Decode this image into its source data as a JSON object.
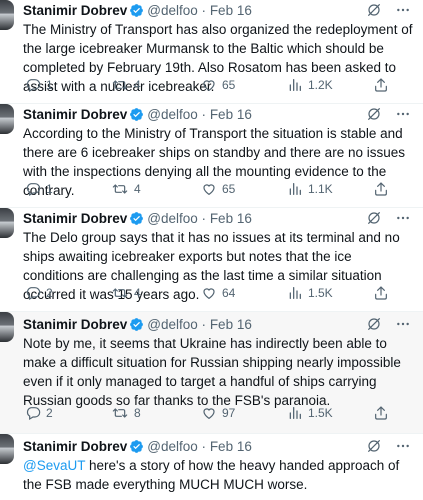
{
  "author": {
    "name": "Stanimir Dobrev",
    "handle": "@delfoo",
    "sep": "·",
    "date": "Feb 16"
  },
  "colors": {
    "accent": "#1d9bf0",
    "text": "#0f1419",
    "secondary": "#536471",
    "highlight_bg": "#f7f7f7"
  },
  "icons": {
    "top": [
      "grok-slash-icon",
      "more-icon"
    ],
    "actions": [
      "reply-icon",
      "retweet-icon",
      "like-icon",
      "views-icon",
      "share-icon"
    ]
  },
  "tweets": [
    {
      "text": "The Ministry of Transport has also organized the redeployment of the large icebreaker Murmansk to the Baltic which should be completed by February 19th. Also Rosatom has been asked to assist with a nuclear icebreaker.",
      "replies": "1",
      "retweets": "4",
      "likes": "65",
      "views": "1.2K"
    },
    {
      "text": "According to the Ministry of Transport the situation is stable and there are 6 icebreaker ships on standby and there are no issues with the inspections denying all the mounting evidence to the contrary.",
      "replies": "1",
      "retweets": "4",
      "likes": "65",
      "views": "1.1K"
    },
    {
      "text": "The Delo group says that it has no issues at its terminal and no ships awaiting icebreaker exports but notes that the ice conditions are challenging as the last time a similar situation occurred it was 15 years ago.",
      "replies": "2",
      "retweets": "4",
      "likes": "64",
      "views": "1.5K"
    },
    {
      "text": "Note by me, it seems that Ukraine has indirectly been able to make a difficult situation for Russian shipping nearly impossible even if it only managed to target a handful of ships carrying Russian goods so far thanks to the FSB's paranoia.",
      "replies": "2",
      "retweets": "8",
      "likes": "97",
      "views": "1.5K"
    },
    {
      "mention": "@SevaUT",
      "text": " here's a story of how the heavy handed approach of the FSB made everything MUCH MUCH worse."
    }
  ]
}
